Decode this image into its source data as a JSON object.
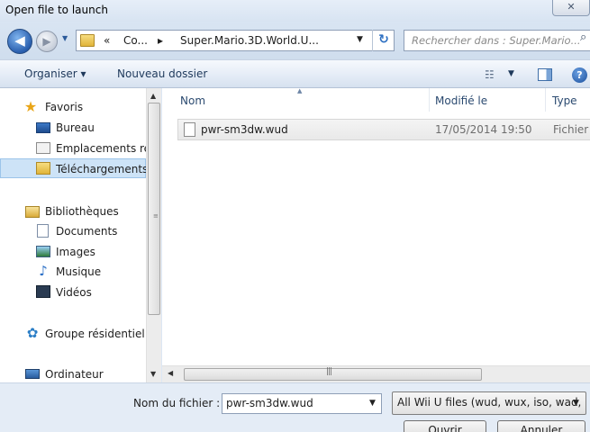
{
  "window": {
    "title": "Open file to launch",
    "close_glyph": "✕"
  },
  "address": {
    "back_glyph": "◀",
    "forward_glyph": "▶",
    "breadcrumbs": [
      "«",
      "Co...",
      "▸",
      "Super.Mario.3D.World.U..."
    ],
    "search_placeholder": "Rechercher dans : Super.Mario...",
    "refresh_glyph": "↻"
  },
  "toolbar": {
    "organize": "Organiser ▾",
    "new_folder": "Nouveau dossier"
  },
  "sidebar": {
    "favorites": "Favoris",
    "bureau": "Bureau",
    "emplacements": "Emplacements récents",
    "telechargements": "Téléchargements",
    "bibliotheques": "Bibliothèques",
    "documents": "Documents",
    "images": "Images",
    "musique": "Musique",
    "videos": "Vidéos",
    "groupe": "Groupe résidentiel",
    "ordinateur": "Ordinateur"
  },
  "columns": {
    "name": "Nom",
    "modified": "Modifié le",
    "type": "Type"
  },
  "files": [
    {
      "name": "pwr-sm3dw.wud",
      "modified": "17/05/2014 19:50",
      "type": "Fichier WUD"
    }
  ],
  "bottom": {
    "filename_label": "Nom du fichier :",
    "filename_value": "pwr-sm3dw.wud",
    "filetype": "All Wii U files (wud, wux, iso, wad, rpx, elf)",
    "open": "Ouvrir",
    "cancel": "Annuler"
  },
  "colors": {
    "accent": "#2b6fc6",
    "selection": "#cde3f7",
    "title_bar": "#dce7f4"
  }
}
